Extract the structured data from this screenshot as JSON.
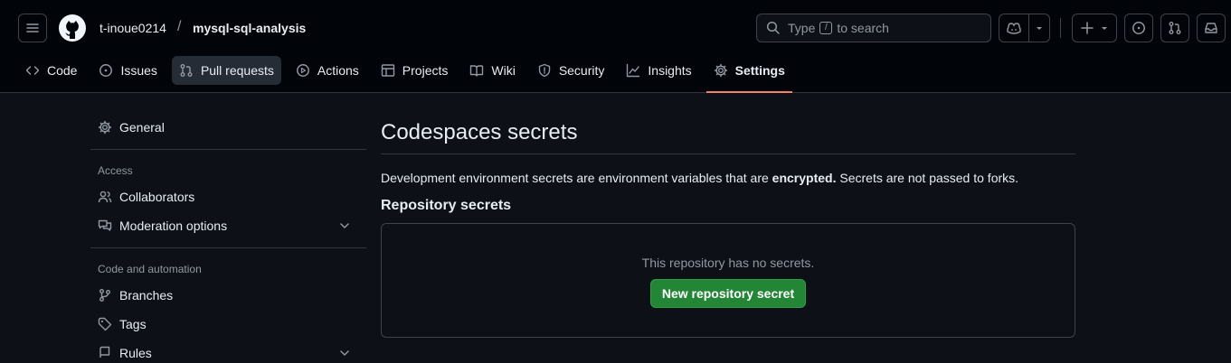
{
  "header": {
    "owner": "t-inoue0214",
    "separator": "/",
    "repo": "mysql-sql-analysis",
    "search": {
      "prefix": "Type",
      "key": "/",
      "suffix": "to search"
    }
  },
  "tabs": [
    {
      "label": "Code",
      "icon": "code-icon"
    },
    {
      "label": "Issues",
      "icon": "issue-opened-icon"
    },
    {
      "label": "Pull requests",
      "icon": "git-pull-request-icon"
    },
    {
      "label": "Actions",
      "icon": "play-icon"
    },
    {
      "label": "Projects",
      "icon": "table-icon"
    },
    {
      "label": "Wiki",
      "icon": "book-icon"
    },
    {
      "label": "Security",
      "icon": "shield-icon"
    },
    {
      "label": "Insights",
      "icon": "graph-icon"
    },
    {
      "label": "Settings",
      "icon": "gear-icon"
    }
  ],
  "sidebar": {
    "general": "General",
    "access_heading": "Access",
    "collaborators": "Collaborators",
    "moderation": "Moderation options",
    "code_heading": "Code and automation",
    "branches": "Branches",
    "tags": "Tags",
    "rules": "Rules"
  },
  "main": {
    "title": "Codespaces secrets",
    "desc_before": "Development environment secrets are environment variables that are ",
    "desc_bold": "encrypted.",
    "desc_after": " Secrets are not passed to forks.",
    "subtitle": "Repository secrets",
    "empty": "This repository has no secrets.",
    "new_button": "New repository secret"
  },
  "colors": {
    "background": "#0d1117",
    "header_bg": "#010409",
    "active_tab_underline": "#f78166",
    "primary_button": "#238636"
  }
}
